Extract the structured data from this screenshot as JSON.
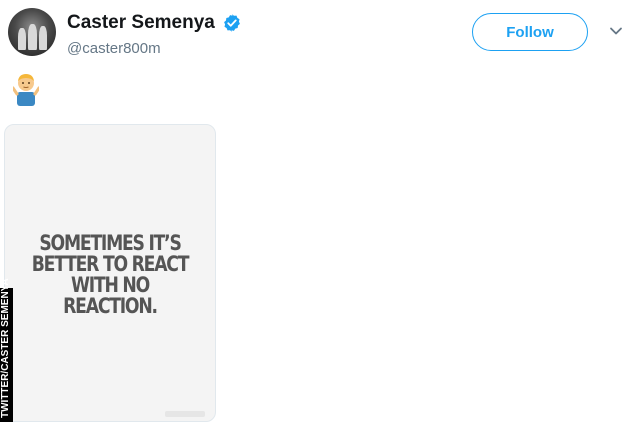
{
  "tweet": {
    "display_name": "Caster Semenya",
    "handle": "@caster800m",
    "verified": true,
    "follow_label": "Follow",
    "body_emoji": "🤷‍♂️",
    "media": {
      "quote_lines": [
        "Sometimes it’s",
        "better to react",
        "with no",
        "reaction."
      ]
    }
  },
  "image_credit": "TWITTER/CASTER SEMENYA",
  "colors": {
    "accent": "#1da1f2",
    "handle_gray": "#657786",
    "name_black": "#14171a",
    "quote_gray": "#555555"
  },
  "icons": {
    "verified": "verified-badge-icon",
    "caret": "chevron-down-icon",
    "emoji": "man-shrugging-emoji"
  }
}
